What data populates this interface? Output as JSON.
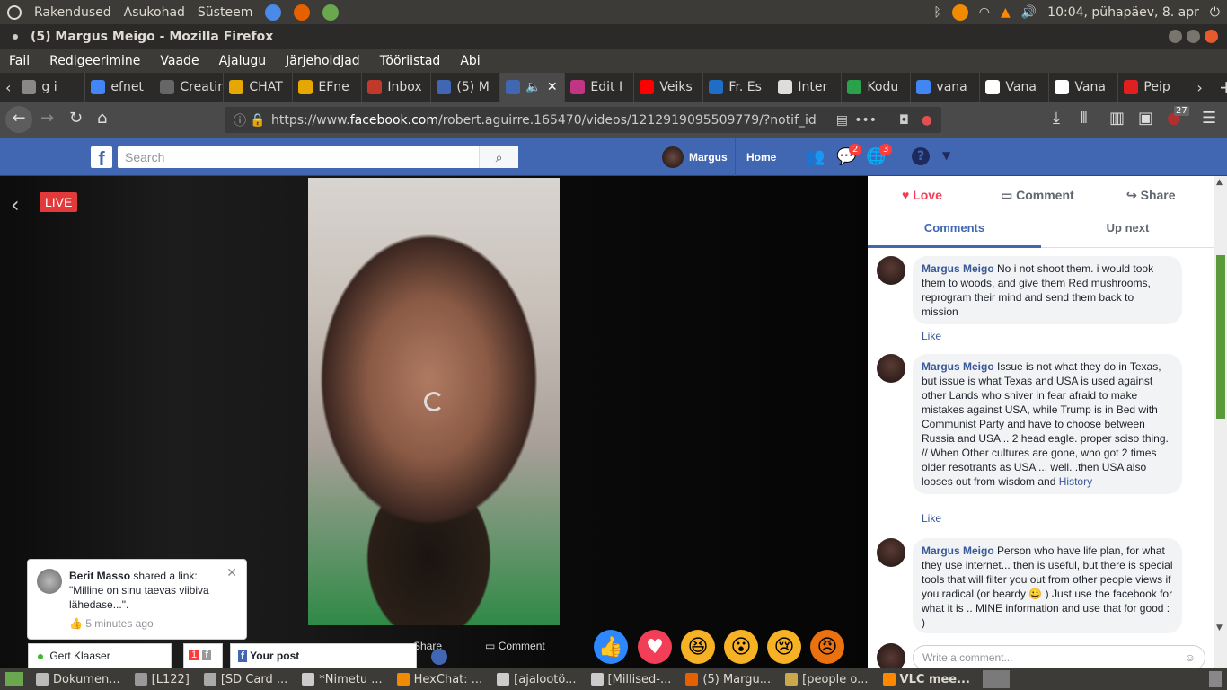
{
  "top_panel": {
    "menus": [
      "Rakendused",
      "Asukohad",
      "Süsteem"
    ],
    "clock": "10:04, pühapäev, 8. apr"
  },
  "window": {
    "title": "(5) Margus Meigo - Mozilla Firefox"
  },
  "menubar": [
    "Fail",
    "Redigeerimine",
    "Vaade",
    "Ajalugu",
    "Järjehoidjad",
    "Tööriistad",
    "Abi"
  ],
  "tabs": [
    {
      "label": "g i",
      "color": "#888888"
    },
    {
      "label": "efnet",
      "color": "#4285f4"
    },
    {
      "label": "Creating",
      "color": "#666666"
    },
    {
      "label": "CHAT",
      "color": "#e6a800"
    },
    {
      "label": "EFne",
      "color": "#e6a800"
    },
    {
      "label": "Inbox",
      "color": "#c0392b"
    },
    {
      "label": "(5) M",
      "color": "#4267b2"
    },
    {
      "label": "",
      "color": "#4267b2",
      "active": true
    },
    {
      "label": "Edit I",
      "color": "#c13584"
    },
    {
      "label": "Veiks",
      "color": "#ff0000"
    },
    {
      "label": "Fr. Es",
      "color": "#1e6ec8"
    },
    {
      "label": "Inter",
      "color": "#dddddd"
    },
    {
      "label": "Kodu",
      "color": "#2aa14b"
    },
    {
      "label": "vana",
      "color": "#4285f4"
    },
    {
      "label": "Vana",
      "color": "#ffffff"
    },
    {
      "label": "Vana",
      "color": "#ffffff"
    },
    {
      "label": "Peip",
      "color": "#e02020"
    }
  ],
  "url": {
    "prefix": "https://www.",
    "host": "facebook.com",
    "path": "/robert.aguirre.165470/videos/1212919095509779/?notif_id"
  },
  "toolbar_badge": "27",
  "fb": {
    "search_placeholder": "Search",
    "user": "Margus",
    "home": "Home",
    "messages_badge": "2",
    "notif_badge": "3"
  },
  "video": {
    "live_label": "LIVE"
  },
  "notification": {
    "author": "Berit Masso",
    "text_after_author": " shared a link:",
    "line2": "\"Milline on sinu taevas viibiva",
    "line3": "lähedase...\".",
    "time": "5 minutes ago"
  },
  "bottom_actions": {
    "share": "Share",
    "comment": "Comment"
  },
  "chat": {
    "contact": "Gert Klaaser",
    "count": "1",
    "your_post": "Your post"
  },
  "panel": {
    "love": "Love",
    "comment": "Comment",
    "share": "Share",
    "tab_comments": "Comments",
    "tab_upnext": "Up next",
    "comments": [
      {
        "author": "Margus Meigo",
        "text": "No i not shoot them. i would took them to woods, and give them Red mushrooms, reprogram their mind and send them back to mission",
        "like": "Like"
      },
      {
        "author": "Margus Meigo",
        "text": "Issue is not what they do in Texas, but issue is what Texas and USA is used against other Lands who shiver in fear afraid to make mistakes against USA, while Trump is in Bed with Communist Party and have to choose between Russia and USA .. 2 head eagle. proper sciso thing. // When Other cultures are gone, who got 2 times older resotrants as USA ... well. .then USA also looses out from wisdom and",
        "link": "History",
        "like": "Like"
      },
      {
        "author": "Margus Meigo",
        "text": "Person who have life plan, for what they use internet... then is useful, but there is special tools that will filter you out from other people views if you radical (or beardy 😀 ) Just use the facebook for what it is .. MINE information and use that for good : )"
      }
    ],
    "write_placeholder": "Write a comment..."
  },
  "taskbar": [
    "Dokumen...",
    "[L122]",
    "[SD Card ...",
    "*Nimetu ...",
    "HexChat: ...",
    "[ajalootö...",
    "[Millised-...",
    "(5) Margu...",
    "[people o...",
    "VLC mee..."
  ]
}
